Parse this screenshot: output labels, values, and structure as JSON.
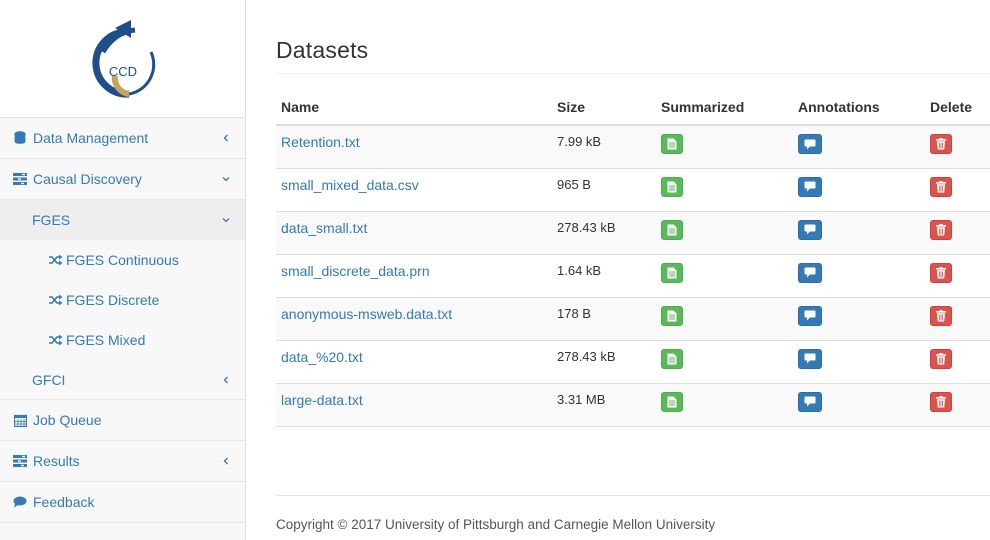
{
  "logo": {
    "text": "CCD"
  },
  "sidebar": {
    "items": [
      {
        "label": "Data Management",
        "icon": "database-icon",
        "chevron": "left"
      },
      {
        "label": "Causal Discovery",
        "icon": "tasks-icon",
        "chevron": "down"
      }
    ],
    "fges": {
      "label": "FGES",
      "chevron": "down"
    },
    "fges_items": [
      {
        "label": "FGES Continuous",
        "icon": "random-icon"
      },
      {
        "label": "FGES Discrete",
        "icon": "random-icon"
      },
      {
        "label": "FGES Mixed",
        "icon": "random-icon"
      }
    ],
    "gfci": {
      "label": "GFCI",
      "chevron": "left"
    },
    "bottom_items": [
      {
        "label": "Job Queue",
        "icon": "calendar-icon"
      },
      {
        "label": "Results",
        "icon": "tasks-icon",
        "chevron": "left"
      },
      {
        "label": "Feedback",
        "icon": "comment-icon"
      }
    ]
  },
  "main": {
    "title": "Datasets",
    "columns": [
      "Name",
      "Size",
      "Summarized",
      "Annotations",
      "Delete"
    ],
    "rows": [
      {
        "name": "Retention.txt",
        "size": "7.99 kB"
      },
      {
        "name": "small_mixed_data.csv",
        "size": "965 B"
      },
      {
        "name": "data_small.txt",
        "size": "278.43 kB"
      },
      {
        "name": "small_discrete_data.prn",
        "size": "1.64 kB"
      },
      {
        "name": "anonymous-msweb.data.txt",
        "size": "178 B"
      },
      {
        "name": "data_%20.txt",
        "size": "278.43 kB"
      },
      {
        "name": "large-data.txt",
        "size": "3.31 MB"
      }
    ]
  },
  "footer": {
    "text": "Copyright © 2017 University of Pittsburgh and Carnegie Mellon University"
  },
  "colors": {
    "link": "#337ab7",
    "green": "#5cb85c",
    "blue": "#337ab7",
    "red": "#d9534f"
  }
}
